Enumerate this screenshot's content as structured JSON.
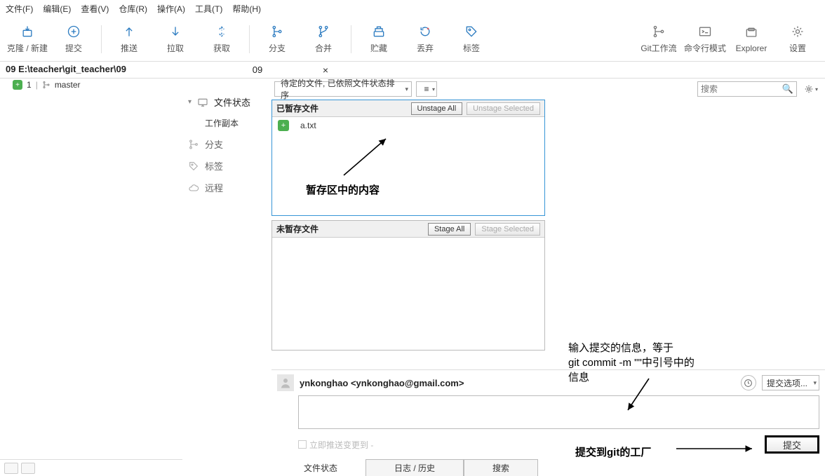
{
  "menu": [
    "文件(F)",
    "编辑(E)",
    "查看(V)",
    "仓库(R)",
    "操作(A)",
    "工具(T)",
    "帮助(H)"
  ],
  "toolbar": {
    "clone": "克隆 / 新建",
    "commit": "提交",
    "push": "推送",
    "pull": "拉取",
    "fetch": "获取",
    "branch": "分支",
    "merge": "合并",
    "stash": "贮藏",
    "discard": "丢弃",
    "tag": "标签",
    "gitflow": "Git工作流",
    "terminal": "命令行模式",
    "explorer": "Explorer",
    "settings": "设置"
  },
  "repo": {
    "path": "09  E:\\teacher\\git_teacher\\09",
    "tab": "09",
    "branch_count": "1",
    "branch_name": "master"
  },
  "sidebar": {
    "file_status": "文件状态",
    "working_copy": "工作副本",
    "branches": "分支",
    "tags": "标签",
    "remotes": "远程"
  },
  "main": {
    "filter": "待定的文件, 已依照文件状态排序",
    "list_icon": "≡",
    "search_placeholder": "搜索",
    "staged": {
      "title": "已暂存文件",
      "unstage_all": "Unstage All",
      "unstage_selected": "Unstage Selected",
      "files": [
        {
          "name": "a.txt"
        }
      ]
    },
    "unstaged": {
      "title": "未暂存文件",
      "stage_all": "Stage All",
      "stage_selected": "Stage Selected"
    }
  },
  "commit": {
    "author": "ynkonghao <ynkonghao@gmail.com>",
    "options": "提交选项...",
    "push_immediately": "立即推送变更到 -",
    "commit_btn": "提交"
  },
  "bottom_tabs": {
    "status": "文件状态",
    "log": "日志 / 历史",
    "search": "搜索"
  },
  "annotations": {
    "staged_note": "暂存区中的内容",
    "commit_msg_note": "输入提交的信息，等于\ngit commit -m \"\"中引号中的\n信息",
    "submit_note": "提交到git的工厂"
  }
}
